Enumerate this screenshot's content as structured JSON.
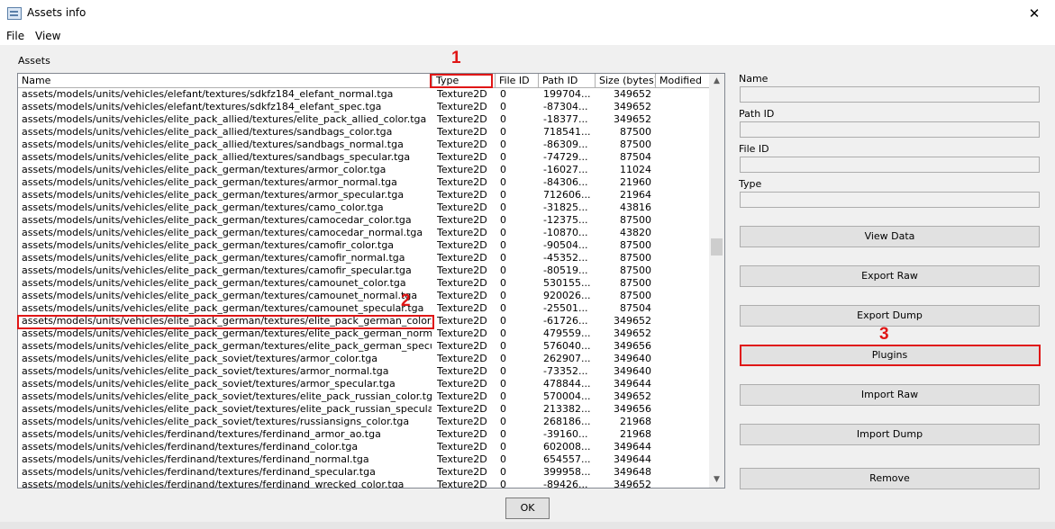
{
  "window": {
    "title": "Assets info",
    "close_glyph": "✕"
  },
  "menu": {
    "items": [
      "File",
      "View"
    ]
  },
  "assets_group_label": "Assets",
  "table": {
    "columns": [
      "Name",
      "Type",
      "File ID",
      "Path ID",
      "Size (bytes)",
      "Modified"
    ],
    "rows": [
      [
        "assets/models/units/vehicles/elefant/textures/sdkfz184_elefant_normal.tga",
        "Texture2D",
        "0",
        "199704...",
        "349652"
      ],
      [
        "assets/models/units/vehicles/elefant/textures/sdkfz184_elefant_spec.tga",
        "Texture2D",
        "0",
        "-87304...",
        "349652"
      ],
      [
        "assets/models/units/vehicles/elite_pack_allied/textures/elite_pack_allied_color.tga",
        "Texture2D",
        "0",
        "-18377...",
        "349652"
      ],
      [
        "assets/models/units/vehicles/elite_pack_allied/textures/sandbags_color.tga",
        "Texture2D",
        "0",
        "718541...",
        "87500"
      ],
      [
        "assets/models/units/vehicles/elite_pack_allied/textures/sandbags_normal.tga",
        "Texture2D",
        "0",
        "-86309...",
        "87500"
      ],
      [
        "assets/models/units/vehicles/elite_pack_allied/textures/sandbags_specular.tga",
        "Texture2D",
        "0",
        "-74729...",
        "87504"
      ],
      [
        "assets/models/units/vehicles/elite_pack_german/textures/armor_color.tga",
        "Texture2D",
        "0",
        "-16027...",
        "11024"
      ],
      [
        "assets/models/units/vehicles/elite_pack_german/textures/armor_normal.tga",
        "Texture2D",
        "0",
        "-84306...",
        "21960"
      ],
      [
        "assets/models/units/vehicles/elite_pack_german/textures/armor_specular.tga",
        "Texture2D",
        "0",
        "712606...",
        "21964"
      ],
      [
        "assets/models/units/vehicles/elite_pack_german/textures/camo_color.tga",
        "Texture2D",
        "0",
        "-31825...",
        "43816"
      ],
      [
        "assets/models/units/vehicles/elite_pack_german/textures/camocedar_color.tga",
        "Texture2D",
        "0",
        "-12375...",
        "87500"
      ],
      [
        "assets/models/units/vehicles/elite_pack_german/textures/camocedar_normal.tga",
        "Texture2D",
        "0",
        "-10870...",
        "43820"
      ],
      [
        "assets/models/units/vehicles/elite_pack_german/textures/camofir_color.tga",
        "Texture2D",
        "0",
        "-90504...",
        "87500"
      ],
      [
        "assets/models/units/vehicles/elite_pack_german/textures/camofir_normal.tga",
        "Texture2D",
        "0",
        "-45352...",
        "87500"
      ],
      [
        "assets/models/units/vehicles/elite_pack_german/textures/camofir_specular.tga",
        "Texture2D",
        "0",
        "-80519...",
        "87500"
      ],
      [
        "assets/models/units/vehicles/elite_pack_german/textures/camounet_color.tga",
        "Texture2D",
        "0",
        "530155...",
        "87500"
      ],
      [
        "assets/models/units/vehicles/elite_pack_german/textures/camounet_normal.tga",
        "Texture2D",
        "0",
        "920026...",
        "87500"
      ],
      [
        "assets/models/units/vehicles/elite_pack_german/textures/camounet_specular.tga",
        "Texture2D",
        "0",
        "-25501...",
        "87504"
      ],
      [
        "assets/models/units/vehicles/elite_pack_german/textures/elite_pack_german_color.tga",
        "Texture2D",
        "0",
        "-61726...",
        "349652"
      ],
      [
        "assets/models/units/vehicles/elite_pack_german/textures/elite_pack_german_normal.tga",
        "Texture2D",
        "0",
        "479559...",
        "349652"
      ],
      [
        "assets/models/units/vehicles/elite_pack_german/textures/elite_pack_german_specular.tga",
        "Texture2D",
        "0",
        "576040...",
        "349656"
      ],
      [
        "assets/models/units/vehicles/elite_pack_soviet/textures/armor_color.tga",
        "Texture2D",
        "0",
        "262907...",
        "349640"
      ],
      [
        "assets/models/units/vehicles/elite_pack_soviet/textures/armor_normal.tga",
        "Texture2D",
        "0",
        "-73352...",
        "349640"
      ],
      [
        "assets/models/units/vehicles/elite_pack_soviet/textures/armor_specular.tga",
        "Texture2D",
        "0",
        "478844...",
        "349644"
      ],
      [
        "assets/models/units/vehicles/elite_pack_soviet/textures/elite_pack_russian_color.tga",
        "Texture2D",
        "0",
        "570004...",
        "349652"
      ],
      [
        "assets/models/units/vehicles/elite_pack_soviet/textures/elite_pack_russian_specular.tga",
        "Texture2D",
        "0",
        "213382...",
        "349656"
      ],
      [
        "assets/models/units/vehicles/elite_pack_soviet/textures/russiansigns_color.tga",
        "Texture2D",
        "0",
        "268186...",
        "21968"
      ],
      [
        "assets/models/units/vehicles/ferdinand/textures/ferdinand_armor_ao.tga",
        "Texture2D",
        "0",
        "-39160...",
        "21968"
      ],
      [
        "assets/models/units/vehicles/ferdinand/textures/ferdinand_color.tga",
        "Texture2D",
        "0",
        "602008...",
        "349644"
      ],
      [
        "assets/models/units/vehicles/ferdinand/textures/ferdinand_normal.tga",
        "Texture2D",
        "0",
        "654557...",
        "349644"
      ],
      [
        "assets/models/units/vehicles/ferdinand/textures/ferdinand_specular.tga",
        "Texture2D",
        "0",
        "399958...",
        "349648"
      ],
      [
        "assets/models/units/vehicles/ferdinand/textures/ferdinand_wrecked_color.tga",
        "Texture2D",
        "0",
        "-89426...",
        "349652"
      ]
    ]
  },
  "scroll": {
    "up_glyph": "▲",
    "down_glyph": "▼"
  },
  "details": {
    "name_label": "Name",
    "path_id_label": "Path ID",
    "file_id_label": "File ID",
    "type_label": "Type"
  },
  "buttons": {
    "view_data": "View Data",
    "export_raw": "Export Raw",
    "export_dump": "Export Dump",
    "plugins": "Plugins",
    "import_raw": "Import Raw",
    "import_dump": "Import Dump",
    "remove": "Remove",
    "ok": "OK"
  },
  "annotations": {
    "one": "1",
    "two": "2",
    "three": "3"
  },
  "colors": {
    "annotation": "#e01616",
    "window": "#f0f0f0",
    "button": "#e1e1e1"
  }
}
